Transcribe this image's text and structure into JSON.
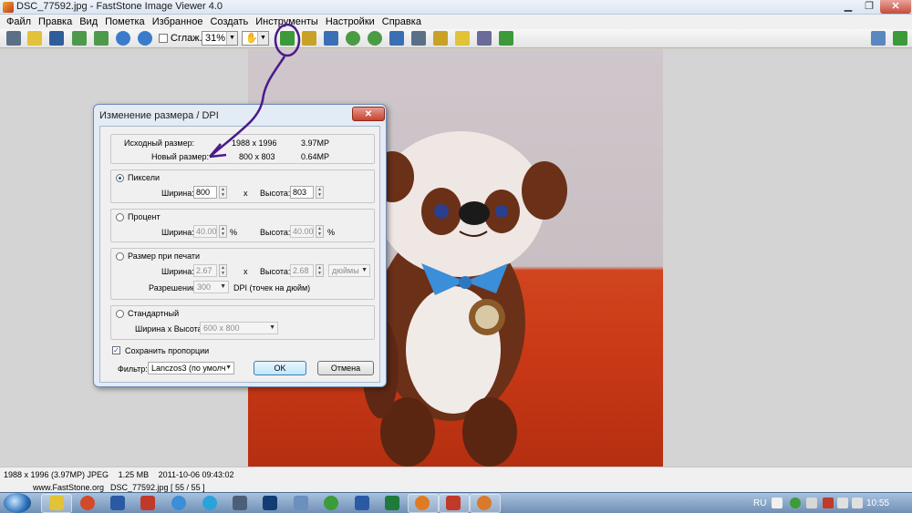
{
  "window": {
    "title": "DSC_77592.jpg  -  FastStone Image Viewer 4.0",
    "minimize_label": "▁",
    "maximize_label": "❐",
    "close_label": "✕"
  },
  "menu": [
    "Файл",
    "Правка",
    "Вид",
    "Пометка",
    "Избранное",
    "Создать",
    "Инструменты",
    "Настройки",
    "Справка"
  ],
  "toolbar": {
    "smooth_label": "Сглаж.",
    "zoom_value": "31%"
  },
  "dialog": {
    "title": "Изменение размера / DPI",
    "close_label": "✕",
    "original_size_label": "Исходный размер:",
    "original_size_value": "1988 x 1996",
    "original_mp": "3.97MP",
    "new_size_label": "Новый размер:",
    "new_size_value": "800 x 803",
    "new_mp": "0.64MP",
    "pixels": {
      "label": "Пиксели",
      "width_label": "Ширина:",
      "width_value": "800",
      "x": "x",
      "height_label": "Высота:",
      "height_value": "803"
    },
    "percent": {
      "label": "Процент",
      "width_label": "Ширина:",
      "width_value": "40.00",
      "unit": "%",
      "height_label": "Высота:",
      "height_value": "40.00"
    },
    "print": {
      "label": "Размер при печати",
      "width_label": "Ширина:",
      "width_value": "2.67",
      "x": "x",
      "height_label": "Высота:",
      "height_value": "2.68",
      "unit_value": "дюймы",
      "resolution_label": "Разрешение:",
      "resolution_value": "300",
      "dpi_label": "DPI (точек на дюйм)"
    },
    "standard": {
      "label": "Стандартный",
      "size_label": "Ширина x Высота:",
      "size_value": "600 x 800"
    },
    "keep_ratio_label": "Сохранить пропорции",
    "filter_label": "Фильтр:",
    "filter_value": "Lanczos3 (по умолч",
    "ok_label": "OK",
    "cancel_label": "Отмена"
  },
  "status": {
    "info": "1988 x 1996 (3.97MP) JPEG",
    "filesize": "1.25 MB",
    "datetime": "2011-10-06 09:43:02",
    "website": "www.FastStone.org",
    "file_position": "DSC_77592.jpg [ 55 / 55 ]"
  },
  "taskbar": {
    "language": "RU",
    "clock": "10:55"
  },
  "colors": {
    "annotation": "#4b1a8c",
    "selection": "#3c7fb1"
  }
}
